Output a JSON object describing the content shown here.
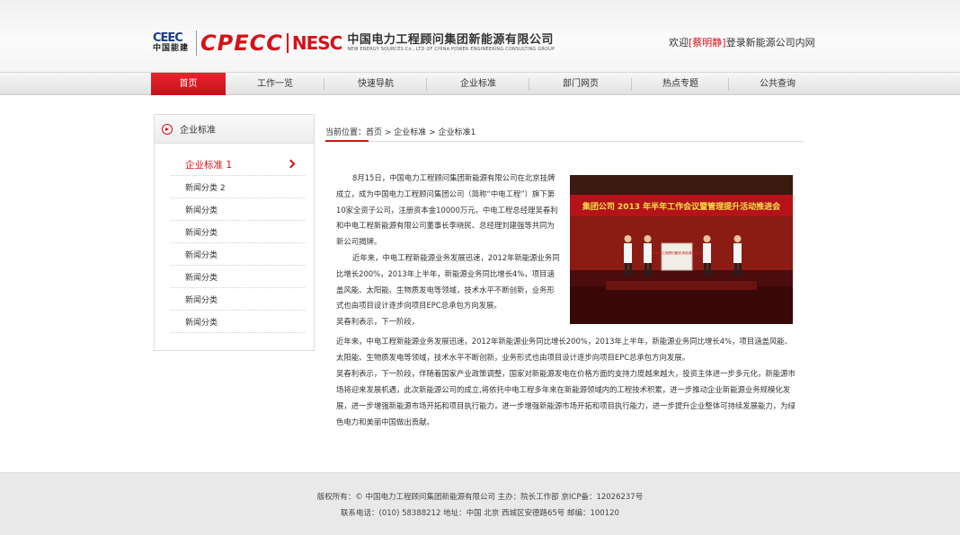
{
  "header": {
    "logo_ceec": "CEEC",
    "logo_ceec_cn": "中国能建",
    "logo_cpecc": "CPECC",
    "logo_nesc": "NESC",
    "company_cn": "中国电力工程顾问集团新能源有限公司",
    "company_en": "NEW ENERGY SOURCES Co., LTD OF CHINA POWER ENGINEERING CONSULTING GROUP",
    "welcome_prefix": "欢迎",
    "username": "[蔡明静]",
    "welcome_suffix": "登录新能源公司内网"
  },
  "nav": {
    "items": [
      {
        "label": "首页",
        "active": true
      },
      {
        "label": "工作一览"
      },
      {
        "label": "快速导航"
      },
      {
        "label": "企业标准"
      },
      {
        "label": "部门网页"
      },
      {
        "label": "热点专题"
      },
      {
        "label": "公共查询"
      }
    ]
  },
  "sidebar": {
    "title": "企业标准",
    "items": [
      {
        "label": "企业标准 1"
      },
      {
        "label": "新闻分类 2"
      },
      {
        "label": "新闻分类"
      },
      {
        "label": "新闻分类"
      },
      {
        "label": "新闻分类"
      },
      {
        "label": "新闻分类"
      },
      {
        "label": "新闻分类"
      },
      {
        "label": "新闻分类"
      }
    ]
  },
  "breadcrumb": {
    "prefix": "当前位置：",
    "items": [
      "首页",
      "企业标准",
      "企业标准1"
    ],
    "sep": " > "
  },
  "article": {
    "p1": "8月15日，中国电力工程顾问集团新能源有限公司在北京挂牌成立，成为中国电力工程顾问集团公司（简称“中电工程”）旗下第10家全资子公司，注册资本金10000万元。中电工程总经理吴春利和中电工程新能源有限公司董事长李晓民、总经理刘建强等共同为新公司揭牌。",
    "p2": "近年来，中电工程新能源业务发展迅速，2012年新能源业务同比增长200%，2013年上半年，新能源业务同比增长4%，项目涵盖风能、太阳能、生物质发电等领域，技术水平不断创新，业务形式也由项目设计逐步向项目EPC总承包方向发展。",
    "p3": "吴春利表示，下一阶段，",
    "p4": "近年来，中电工程新能源业务发展迅速，2012年新能源业务同比增长200%，2013年上半年，新能源业务同比增长4%，项目涵盖风能、太阳能、生物质发电等领域，技术水平不断创新，业务形式也由项目设计逐步向项目EPC总承包方向发展。",
    "p5": "吴春利表示，下一阶段，伴随着国家产业政策调整，国家对新能源发电在价格方面的支持力度越来越大，投资主体进一步多元化，新能源市场将迎来发展机遇，此次新能源公司的成立,将依托中电工程多年来在新能源领域内的工程技术积累，进一步推动企业新能源业务规模化发展，进一步增强新能源市场开拓和项目执行能力，进一步增强新能源市场开拓和项目执行能力，进一步提升企业整体可持续发展能力，为绿色电力和美丽中国做出贡献。",
    "photo_banner": "集团公司 2013 年半年工作会议暨管理提升活动推进会",
    "photo_board": "中国电力工程顾问集团 新能源有限公司"
  },
  "footer": {
    "line1": "版权所有：© 中国电力工程顾问集团新能源有限公司  主办：院长工作部  京ICP备：12026237号",
    "line2": "联系电话：(010) 58388212    地址：中国  北京  西城区安德路65号  邮编：100120"
  },
  "colors": {
    "accent": "#d4121a",
    "nav_bg": "#e9e9e9",
    "footer_bg": "#e9e9e9"
  }
}
